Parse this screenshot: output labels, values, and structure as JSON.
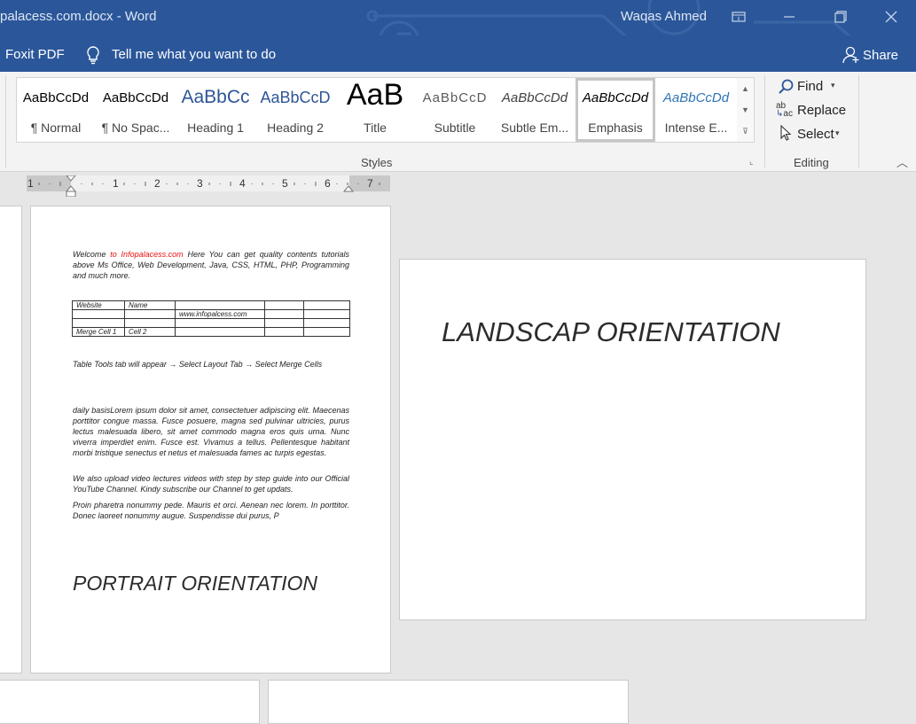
{
  "titlebar": {
    "doc_title": "palacess.com.docx  -  Word",
    "user": "Waqas Ahmed"
  },
  "tellbar": {
    "foxit": "Foxit PDF",
    "tell_me": "Tell me what you want to do",
    "share": "Share"
  },
  "styles": {
    "group_label": "Styles",
    "items": [
      {
        "sample": "AaBbCcDd",
        "name": "¶ Normal"
      },
      {
        "sample": "AaBbCcDd",
        "name": "¶ No Spac..."
      },
      {
        "sample": "AaBbCc",
        "name": "Heading 1"
      },
      {
        "sample": "AaBbCcD",
        "name": "Heading 2"
      },
      {
        "sample": "AaB",
        "name": "Title"
      },
      {
        "sample": "AaBbCcD",
        "name": "Subtitle"
      },
      {
        "sample": "AaBbCcDd",
        "name": "Subtle Em..."
      },
      {
        "sample": "AaBbCcDd",
        "name": "Emphasis"
      },
      {
        "sample": "AaBbCcDd",
        "name": "Intense E..."
      }
    ],
    "selected_index": 7
  },
  "editing": {
    "group_label": "Editing",
    "find": "Find",
    "replace": "Replace",
    "select": "Select"
  },
  "ruler": {
    "numbers": [
      "1",
      "1",
      "2",
      "3",
      "4",
      "5",
      "6",
      "7"
    ]
  },
  "portrait_page": {
    "intro_prefix": "Welcome ",
    "intro_link": "to Infopalacess.com",
    "intro_rest": " Here You can get quality contents tutorials above Ms Office, Web Development, Java, CSS, HTML, PHP, Programming and much more.",
    "table": [
      [
        "Website",
        "Name",
        "",
        "",
        ""
      ],
      [
        "",
        "",
        "www.infopalcess.com",
        "",
        ""
      ],
      [
        "",
        "",
        "",
        "",
        ""
      ],
      [
        "Merge Cell 1",
        "Cell 2",
        "",
        "",
        ""
      ]
    ],
    "instruction": "Table Tools tab will appear → Select Layout Tab → Select Merge Cells",
    "lorem1": " daily basisLorem ipsum dolor sit amet, consectetuer adipiscing elit. Maecenas porttitor congue massa. Fusce posuere, magna sed pulvinar ultricies, purus lectus malesuada libero, sit amet commodo magna eros quis urna. Nunc viverra imperdiet enim. Fusce est. Vivamus a tellus. Pellentesque habitant morbi tristique senectus et netus et malesuada fames ac turpis egestas.",
    "youtube": "We also upload video lectures videos with step by step guide into our Official YouTube Channel. Kindy subscribe our Channel to get updats.",
    "lorem2": "Proin pharetra nonummy pede. Mauris et orci. Aenean nec lorem. In porttitor. Donec laoreet nonummy augue. Suspendisse dui purus, P",
    "orientation_label": "PORTRAIT ORIENTATION"
  },
  "landscape_page": {
    "orientation_label": "LANDSCAP ORIENTATION"
  },
  "colors": {
    "title_blue": "#2b579a",
    "link_red": "#e81010"
  }
}
